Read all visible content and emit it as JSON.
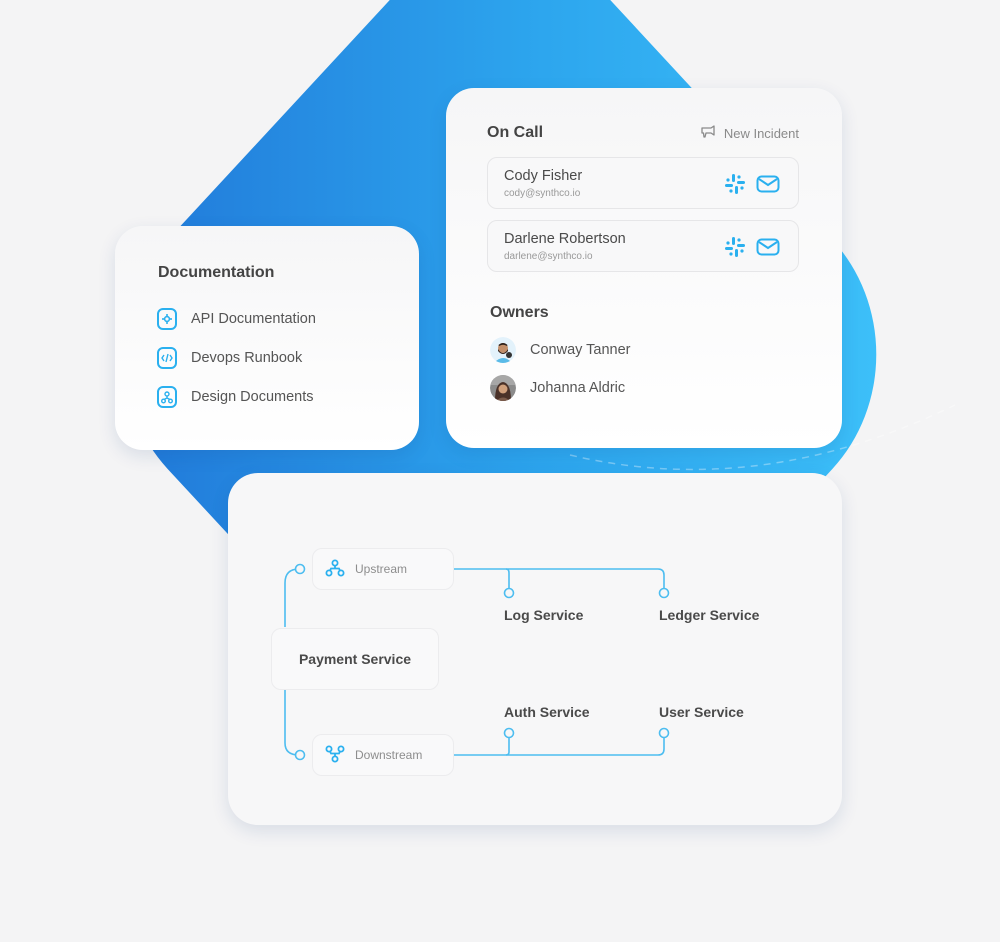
{
  "colors": {
    "accent": "#2ab0ef",
    "diamond_light": "#3fc4fb",
    "diamond_dark": "#1f72d6",
    "background": "#f4f4f5"
  },
  "documentation": {
    "title": "Documentation",
    "items": [
      {
        "label": "API Documentation",
        "icon": "gear-icon"
      },
      {
        "label": "Devops Runbook",
        "icon": "code-icon"
      },
      {
        "label": "Design Documents",
        "icon": "diagram-icon"
      }
    ]
  },
  "on_call": {
    "title": "On Call",
    "new_incident_label": "New Incident",
    "people": [
      {
        "name": "Cody Fisher",
        "email": "cody@synthco.io"
      },
      {
        "name": "Darlene Robertson",
        "email": "darlene@synthco.io"
      }
    ]
  },
  "owners": {
    "title": "Owners",
    "people": [
      {
        "name": "Conway Tanner"
      },
      {
        "name": "Johanna Aldric"
      }
    ]
  },
  "dependency_graph": {
    "center_service": "Payment Service",
    "upstream_label": "Upstream",
    "downstream_label": "Downstream",
    "upstream_services": [
      "Log Service",
      "Ledger Service"
    ],
    "downstream_services": [
      "Auth Service",
      "User Service"
    ]
  }
}
